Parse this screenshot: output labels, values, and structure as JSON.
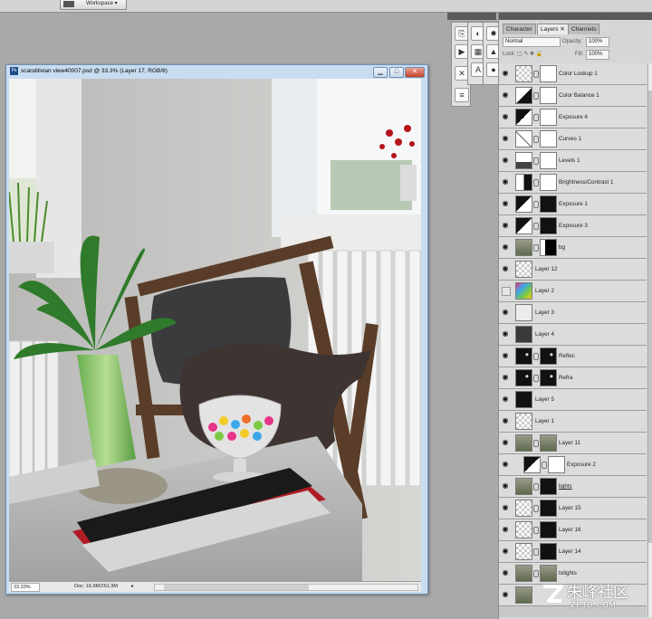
{
  "app": {
    "workspace_label": "Workspace ▾"
  },
  "document": {
    "title": "scandilivian view40007.psd @ 33.3% (Layer 17, RGB/8)",
    "ps_badge": "Ps",
    "minimize": "▁",
    "maximize": "□",
    "close": "✕",
    "zoom": "33.33%",
    "doc_size": "Doc: 16.9M/261.9M",
    "status_arrow": "▸"
  },
  "panel": {
    "tabs": [
      {
        "label": "Character",
        "active": false
      },
      {
        "label": "Layers ✕",
        "active": true
      },
      {
        "label": "Channels",
        "active": false
      }
    ],
    "blend_mode": "Normal",
    "opacity_label": "Opacity:",
    "opacity_value": "100%",
    "lock_label": "Lock:",
    "fill_label": "Fill:",
    "fill_value": "100%"
  },
  "layers": [
    {
      "name": "Color Lookup 1",
      "visible": true,
      "type": "adjust",
      "thumb": "checker",
      "mask": "white"
    },
    {
      "name": "Color Balance 1",
      "visible": true,
      "type": "adjust",
      "thumb": "balance",
      "mask": "white"
    },
    {
      "name": "Exposure 4",
      "visible": true,
      "type": "adjust",
      "thumb": "exposure",
      "mask": "white"
    },
    {
      "name": "Curves 1",
      "visible": true,
      "type": "adjust",
      "thumb": "curves",
      "mask": "white"
    },
    {
      "name": "Levels 1",
      "visible": true,
      "type": "adjust",
      "thumb": "levels",
      "mask": "white"
    },
    {
      "name": "Brightness/Contrast 1",
      "visible": true,
      "type": "adjust",
      "thumb": "brightness",
      "mask": "white"
    },
    {
      "name": "Exposure 1",
      "visible": true,
      "type": "adjust",
      "thumb": "exposure",
      "mask": "black"
    },
    {
      "name": "Exposure 3",
      "visible": true,
      "type": "adjust",
      "thumb": "exposure",
      "mask": "black"
    },
    {
      "name": "bg",
      "visible": true,
      "type": "pixel",
      "thumb": "photo",
      "mask": "blackwhite"
    },
    {
      "name": "Layer 12",
      "visible": true,
      "type": "pixel",
      "thumb": "checker",
      "mask": ""
    },
    {
      "name": "Layer 2",
      "visible": false,
      "type": "pixel",
      "thumb": "colorful",
      "mask": ""
    },
    {
      "name": "Layer 3",
      "visible": true,
      "type": "pixel",
      "thumb": "light",
      "mask": ""
    },
    {
      "name": "Layer 4",
      "visible": true,
      "type": "pixel",
      "thumb": "dark",
      "mask": ""
    },
    {
      "name": "Reflec",
      "visible": true,
      "type": "pixel",
      "thumb": "darkspots",
      "mask": "darkspots"
    },
    {
      "name": "Refra",
      "visible": true,
      "type": "pixel",
      "thumb": "darkspots",
      "mask": "darkspots"
    },
    {
      "name": "Layer 5",
      "visible": true,
      "type": "pixel",
      "thumb": "black",
      "mask": ""
    },
    {
      "name": "Layer 1",
      "visible": true,
      "type": "pixel",
      "thumb": "checker",
      "mask": ""
    },
    {
      "name": "Layer 11",
      "visible": true,
      "type": "pixel",
      "thumb": "photo",
      "mask": "photo"
    },
    {
      "name": "Exposure 2",
      "visible": true,
      "type": "adjust",
      "thumb": "exposure",
      "mask": "white",
      "indent": true
    },
    {
      "name": "lights",
      "visible": true,
      "type": "pixel",
      "thumb": "photo",
      "mask": "black",
      "underline": true
    },
    {
      "name": "Layer 15",
      "visible": true,
      "type": "pixel",
      "thumb": "checker",
      "mask": "black"
    },
    {
      "name": "Layer 16",
      "visible": true,
      "type": "pixel",
      "thumb": "checker",
      "mask": "black"
    },
    {
      "name": "Layer 14",
      "visible": true,
      "type": "pixel",
      "thumb": "checker",
      "mask": "black"
    },
    {
      "name": "tolights",
      "visible": true,
      "type": "pixel",
      "thumb": "photo",
      "mask": "photo"
    },
    {
      "name": "",
      "visible": true,
      "type": "pixel",
      "thumb": "photo",
      "mask": ""
    }
  ],
  "watermark": {
    "text": "朱峰社区",
    "url": "ZF3D.COM"
  },
  "colors": {
    "photoshop_bg": "#a9a9a9",
    "window_frame": "#c9ddf1",
    "panel_bg": "#d6d6d6"
  }
}
